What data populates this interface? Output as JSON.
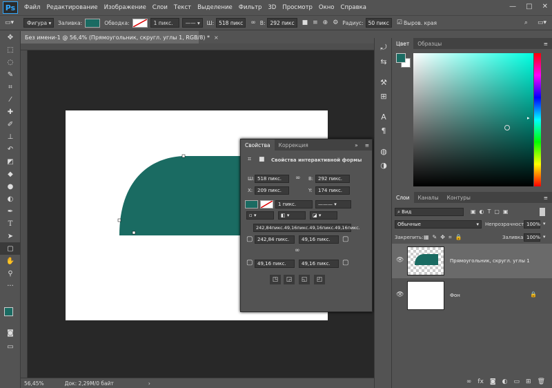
{
  "app": {
    "logo": "Ps"
  },
  "menu": [
    "Файл",
    "Редактирование",
    "Изображение",
    "Слои",
    "Текст",
    "Выделение",
    "Фильтр",
    "3D",
    "Просмотр",
    "Окно",
    "Справка"
  ],
  "window_controls": [
    "—",
    "□",
    "✕"
  ],
  "options": {
    "mode": "Фигура",
    "fill_label": "Заливка:",
    "stroke_label": "Обводка:",
    "stroke_width": "1 пикс.",
    "w_label": "Ш:",
    "w_value": "518 пикс",
    "h_label": "В:",
    "h_value": "292 пикс",
    "radius_label": "Радиус:",
    "radius_value": "50 пикс",
    "align_edges": "Выров. края",
    "fill_color": "#1a6b62"
  },
  "document": {
    "tab_title": "Без имени-1 @ 56,4% (Прямоугольник, скругл. углы 1, RGB/8) *",
    "close": "×",
    "zoom": "56,45%",
    "doc_info": "Док: 2,29М/0 байт",
    "shape_color": "#1a6b62"
  },
  "properties": {
    "tabs": [
      "Свойства",
      "Коррекция"
    ],
    "title": "Свойства интерактивной формы",
    "w_label": "Ш:",
    "w_value": "518 пикс.",
    "h_label": "В:",
    "h_value": "292 пикс.",
    "x_label": "X:",
    "x_value": "209 пикс.",
    "y_label": "Y:",
    "y_value": "174 пикс.",
    "stroke_width": "1 пикс.",
    "corners_summary": "242,84пикс.49,16пикс.49,16пикс.49,16пикс.",
    "corner_tl": "242,84 пикс.",
    "corner_tr": "49,16 пикс.",
    "corner_bl": "49,16 пикс.",
    "corner_br": "49,16 пикс."
  },
  "color_panel": {
    "tabs": [
      "Цвет",
      "Образцы"
    ]
  },
  "layers_panel": {
    "tabs": [
      "Слои",
      "Каналы",
      "Контуры"
    ],
    "filter": "Вид",
    "blend_mode": "Обычные",
    "opacity_label": "Непрозрачность:",
    "opacity_value": "100%",
    "lock_label": "Закрепить:",
    "fill_label": "Заливка:",
    "fill_value": "100%",
    "layers": [
      {
        "name": "Прямоугольник, скругл. углы 1",
        "selected": true
      },
      {
        "name": "Фон",
        "selected": false
      }
    ]
  }
}
